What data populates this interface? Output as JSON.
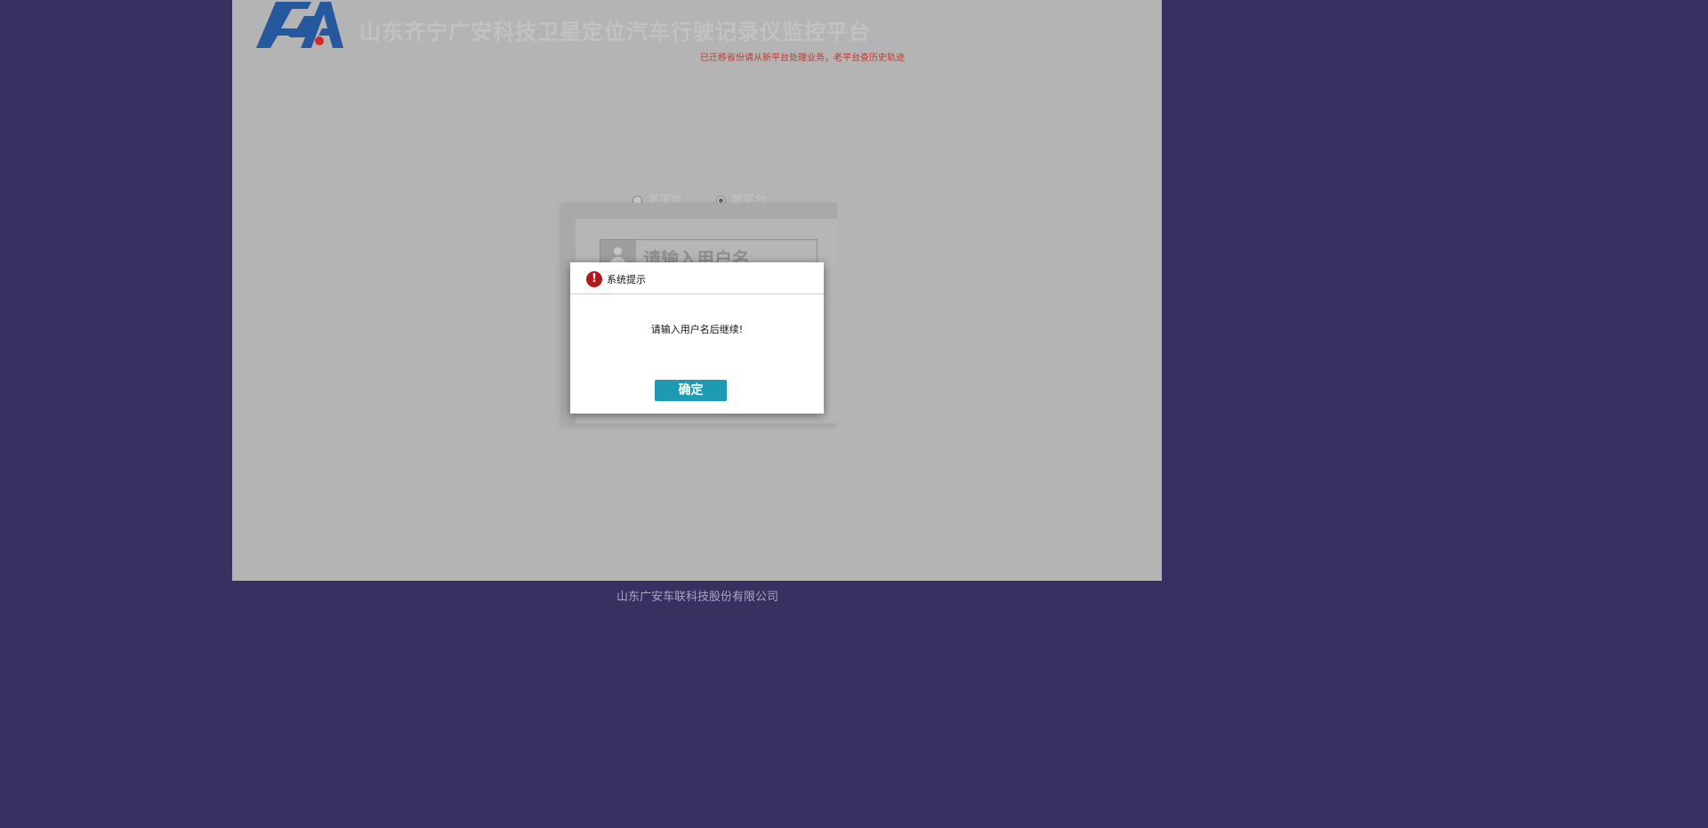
{
  "header": {
    "site_title": "山东齐宁广安科技卫星定位汽车行驶记录仪监控平台",
    "migration_notice": "已迁移省份请从新平台处理业务，老平台查历史轨迹"
  },
  "platform_switch": {
    "options": [
      {
        "label": "老平台",
        "checked": false
      },
      {
        "label": "新平台",
        "checked": true
      }
    ]
  },
  "login": {
    "username_placeholder": "请输入用户名"
  },
  "dialog": {
    "title": "系统提示",
    "message": "请输入用户名后继续!",
    "confirm_label": "确定",
    "warn_symbol": "!",
    "warn_color": "#b3171c",
    "button_color": "#1e9bb3"
  },
  "footer": {
    "company": "山东广安车联科技股份有限公司"
  },
  "colors": {
    "background": "#363161",
    "overlay": "#b4b4b4",
    "notice": "#c0392b"
  }
}
